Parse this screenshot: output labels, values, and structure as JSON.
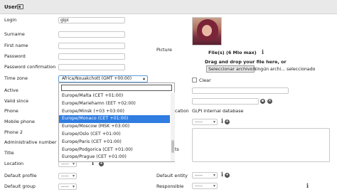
{
  "header": {
    "title": "User",
    "icon": "card-icon"
  },
  "left_labels": {
    "login": "Login",
    "surname": "Surname",
    "first_name": "First name",
    "password": "Password",
    "password_confirmation": "Password confirmation",
    "time_zone": "Time zone",
    "active": "Active",
    "valid_since": "Valid since",
    "phone": "Phone",
    "mobile_phone": "Mobile phone",
    "phone2": "Phone 2",
    "admin_number": "Administrative number",
    "title": "Title",
    "location": "Location",
    "default_profile": "Default profile",
    "default_group": "Default group"
  },
  "fields": {
    "login_value": "glpi",
    "dash": "-----"
  },
  "timezone": {
    "selected": "Africa/Nouakchott (GMT +00:00)",
    "options": [
      "Europe/Malta (CET +01:00)",
      "Europe/Mariehamn (EET +02:00)",
      "Europe/Minsk (+03 +03:00)",
      "Europe/Monaco (CET +01:00)",
      "Europe/Moscow (MSK +03:00)",
      "Europe/Oslo (CET +01:00)",
      "Europe/Paris (CET +01:00)",
      "Europe/Podgorica (CET +01:00)",
      "Europe/Prague (CET +01:00)"
    ],
    "highlighted_index": 3
  },
  "right": {
    "picture_label": "Picture",
    "files_label": "File(s) (6 Mio max)",
    "drop_text": "Drag and drop your file here, or",
    "file_button": "Seleccionar archivo",
    "file_status": "Ningún archi... seleccionado",
    "clear_label": "Clear",
    "auth_partial": "cation",
    "auth_value": "GLPI internal database",
    "comments_partial": "ts",
    "default_entity": "Default entity",
    "responsible": "Responsible"
  },
  "colors": {
    "highlight": "#2f7de1",
    "header_bg": "#e9e9e9"
  }
}
